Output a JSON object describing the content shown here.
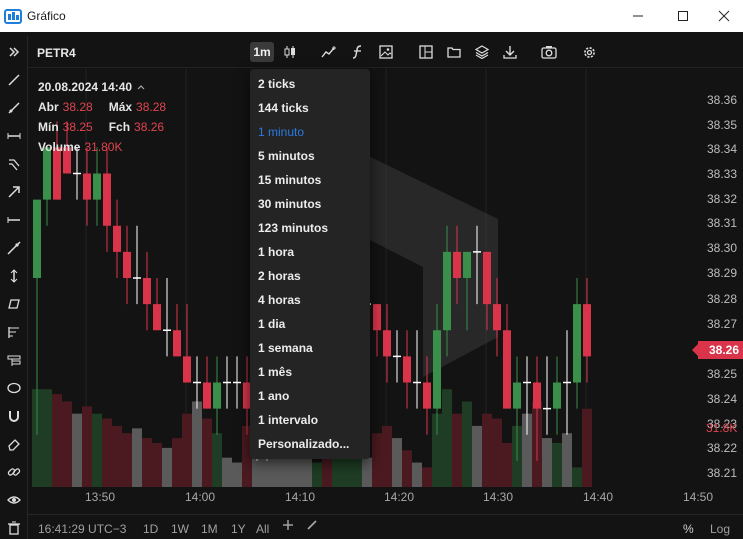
{
  "window": {
    "title": "Gráfico"
  },
  "toolbar": {
    "symbol": "PETR4",
    "interval_label": "1m"
  },
  "legend": {
    "date": "20.08.2024 14:40",
    "open_label": "Abr",
    "open_value": "38.28",
    "high_label": "Máx",
    "high_value": "38.28",
    "low_label": "Mín",
    "low_value": "38.25",
    "close_label": "Fch",
    "close_value": "38.26",
    "volume_label": "Volume",
    "volume_value": "31.80K"
  },
  "price_axis": {
    "labels": [
      "38.36",
      "38.35",
      "38.34",
      "38.33",
      "38.32",
      "38.31",
      "38.30",
      "38.29",
      "38.28",
      "38.27",
      "38.25",
      "38.24",
      "38.23",
      "38.22",
      "38.21"
    ],
    "current_price": "38.26",
    "volume_last": "31.8K"
  },
  "time_axis": {
    "labels": [
      "13:50",
      "14:00",
      "14:10",
      "14:20",
      "14:30",
      "14:40",
      "14:50"
    ]
  },
  "bottom_bar": {
    "clock": "16:41:29 UTC−3",
    "ranges": [
      "1D",
      "1W",
      "1M",
      "1Y",
      "All"
    ],
    "percent": "%",
    "log": "Log"
  },
  "interval_menu": {
    "items": [
      "2 ticks",
      "144 ticks",
      "1 minuto",
      "5 minutos",
      "15 minutos",
      "30 minutos",
      "123 minutos",
      "1 hora",
      "2 horas",
      "4 horas",
      "1 dia",
      "1 semana",
      "1 mês",
      "1 ano",
      "1 intervalo",
      "Personalizado..."
    ],
    "selected": "1 minuto"
  },
  "colors": {
    "up": "#3a8f4a",
    "down": "#d9344a",
    "doji": "#ffffff",
    "accent": "#2a7be4"
  },
  "chart_data": {
    "type": "candlestick",
    "x": [
      "13:45",
      "13:46",
      "13:47",
      "13:48",
      "13:49",
      "13:50",
      "13:51",
      "13:52",
      "13:53",
      "13:54",
      "13:55",
      "13:56",
      "13:57",
      "13:58",
      "13:59",
      "14:00",
      "14:01",
      "14:02",
      "14:03",
      "14:04",
      "14:05",
      "14:06",
      "14:07",
      "14:08",
      "14:09",
      "14:10",
      "14:11",
      "14:12",
      "14:13",
      "14:14",
      "14:15",
      "14:16",
      "14:17",
      "14:18",
      "14:19",
      "14:20",
      "14:21",
      "14:22",
      "14:23",
      "14:24",
      "14:25",
      "14:26",
      "14:27",
      "14:28",
      "14:29",
      "14:30",
      "14:31",
      "14:32",
      "14:33",
      "14:34",
      "14:35",
      "14:36",
      "14:37",
      "14:38",
      "14:39",
      "14:40"
    ],
    "open": [
      38.29,
      38.32,
      38.34,
      38.34,
      38.33,
      38.33,
      38.32,
      38.33,
      38.31,
      38.3,
      38.29,
      38.29,
      38.28,
      38.27,
      38.27,
      38.26,
      38.25,
      38.25,
      38.24,
      38.25,
      38.25,
      38.25,
      38.24,
      38.24,
      38.24,
      38.24,
      38.24,
      38.24,
      38.24,
      38.26,
      38.25,
      38.26,
      38.27,
      38.28,
      38.28,
      38.27,
      38.26,
      38.26,
      38.25,
      38.25,
      38.24,
      38.27,
      38.3,
      38.29,
      38.3,
      38.3,
      38.28,
      38.27,
      38.24,
      38.25,
      38.25,
      38.24,
      38.24,
      38.25,
      38.25,
      38.28
    ],
    "high": [
      38.3,
      38.34,
      38.35,
      38.35,
      38.34,
      38.34,
      38.34,
      38.34,
      38.32,
      38.31,
      38.31,
      38.3,
      38.29,
      38.29,
      38.28,
      38.28,
      38.26,
      38.26,
      38.26,
      38.26,
      38.26,
      38.26,
      38.25,
      38.25,
      38.26,
      38.26,
      38.25,
      38.25,
      38.27,
      38.28,
      38.27,
      38.28,
      38.29,
      38.29,
      38.28,
      38.28,
      38.27,
      38.27,
      38.27,
      38.26,
      38.28,
      38.31,
      38.31,
      38.3,
      38.31,
      38.3,
      38.29,
      38.28,
      38.26,
      38.26,
      38.26,
      38.26,
      38.26,
      38.27,
      38.29,
      38.29
    ],
    "low": [
      38.23,
      38.31,
      38.32,
      38.33,
      38.32,
      38.31,
      38.31,
      38.3,
      38.29,
      38.28,
      38.28,
      38.27,
      38.27,
      38.26,
      38.26,
      38.25,
      38.24,
      38.24,
      38.23,
      38.24,
      38.24,
      38.23,
      38.22,
      38.22,
      38.23,
      38.23,
      38.23,
      38.23,
      38.23,
      38.24,
      38.24,
      38.25,
      38.26,
      38.26,
      38.26,
      38.25,
      38.25,
      38.24,
      38.24,
      38.23,
      38.23,
      38.26,
      38.28,
      38.27,
      38.28,
      38.27,
      38.26,
      38.24,
      38.22,
      38.23,
      38.22,
      38.23,
      38.23,
      38.23,
      38.24,
      38.25
    ],
    "close": [
      38.32,
      38.34,
      38.32,
      38.33,
      38.33,
      38.32,
      38.33,
      38.31,
      38.3,
      38.29,
      38.29,
      38.28,
      38.27,
      38.27,
      38.26,
      38.25,
      38.25,
      38.24,
      38.25,
      38.25,
      38.25,
      38.24,
      38.24,
      38.24,
      38.24,
      38.24,
      38.24,
      38.24,
      38.26,
      38.25,
      38.26,
      38.27,
      38.28,
      38.28,
      38.27,
      38.26,
      38.26,
      38.25,
      38.25,
      38.24,
      38.27,
      38.3,
      38.29,
      38.3,
      38.3,
      38.28,
      38.27,
      38.24,
      38.25,
      38.25,
      38.24,
      38.24,
      38.25,
      38.25,
      38.28,
      38.26
    ],
    "volume": [
      40,
      40,
      38,
      35,
      30,
      33,
      30,
      28,
      25,
      22,
      24,
      20,
      18,
      16,
      20,
      30,
      35,
      28,
      22,
      12,
      10,
      25,
      30,
      20,
      18,
      22,
      15,
      12,
      10,
      18,
      22,
      28,
      20,
      12,
      22,
      25,
      20,
      15,
      10,
      8,
      30,
      40,
      30,
      35,
      25,
      30,
      28,
      18,
      25,
      30,
      35,
      20,
      18,
      22,
      8,
      32
    ],
    "ylim": [
      38.21,
      38.37
    ]
  }
}
